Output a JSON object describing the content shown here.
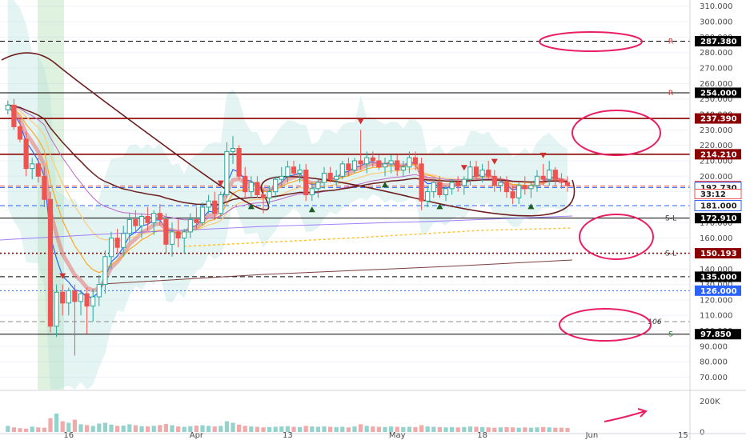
{
  "chart_data": {
    "type": "candlestick",
    "price_axis": {
      "ticks": [
        70,
        80,
        90,
        100,
        110,
        120,
        130,
        140,
        150,
        160,
        170,
        180,
        190,
        200,
        210,
        220,
        230,
        240,
        250,
        260,
        270,
        280,
        290,
        300,
        310
      ],
      "tick_labels": [
        "70.000",
        "80.000",
        "90.000",
        "100.000",
        "110.000",
        "120.000",
        "130.000",
        "140.000",
        "150.000",
        "160.000",
        "170.000",
        "180.000",
        "190.000",
        "200.000",
        "210.000",
        "220.000",
        "230.000",
        "240.000",
        "250.000",
        "260.000",
        "270.000",
        "280.000",
        "290.000",
        "300.000",
        "310.000"
      ],
      "range": [
        62,
        314
      ]
    },
    "volume_axis": {
      "tick_labels": [
        "200K",
        "0"
      ],
      "ticks": [
        200,
        0
      ],
      "range": [
        0,
        260
      ]
    },
    "time_axis": {
      "labels": [
        "16",
        "Apr",
        "13",
        "May",
        "18",
        "Jun",
        "15"
      ],
      "x": [
        10,
        31,
        46,
        64,
        78,
        96,
        111
      ]
    },
    "levels": [
      {
        "value": 287.38,
        "label": "287.380",
        "color": "#000000",
        "style": "dash",
        "marker": "R"
      },
      {
        "value": 254.0,
        "label": "254.000",
        "color": "#000000",
        "style": "solid",
        "marker": "R"
      },
      {
        "value": 237.39,
        "label": "237.390",
        "color": "#8b0000",
        "style": "solid",
        "marker": ""
      },
      {
        "value": 214.21,
        "label": "214.210",
        "color": "#8b0000",
        "style": "solid",
        "marker": ""
      },
      {
        "value": 193.71,
        "label": "193.710",
        "color": "#ef5350",
        "style": "dash",
        "marker": ""
      },
      {
        "value": 192.73,
        "label": "192.730",
        "color": "#2962ff",
        "style": "dash",
        "marker": ""
      },
      {
        "value": 181.0,
        "label": "181.000",
        "color": "#2962ff",
        "style": "dash",
        "marker": ""
      },
      {
        "value": 172.91,
        "label": "172.910",
        "color": "#000000",
        "style": "solid",
        "marker": "S-L"
      },
      {
        "value": 150.193,
        "label": "150.193",
        "color": "#8b0000",
        "style": "dot",
        "marker": "S-L"
      },
      {
        "value": 135.0,
        "label": "135.000",
        "color": "#000000",
        "style": "dash",
        "marker": ""
      },
      {
        "value": 126.0,
        "label": "126.000",
        "color": "#2962ff",
        "style": "dot",
        "marker": ""
      },
      {
        "value": 106.0,
        "label": "",
        "color": "#888888",
        "style": "dash",
        "marker": "106"
      },
      {
        "value": 97.85,
        "label": "97.850",
        "color": "#000000",
        "style": "solid",
        "marker": "S"
      }
    ],
    "countdown": "33:12",
    "candles": [
      [
        0,
        243,
        249,
        240,
        246
      ],
      [
        1,
        246,
        250,
        230,
        232
      ],
      [
        2,
        232,
        237,
        222,
        224
      ],
      [
        3,
        224,
        229,
        200,
        205
      ],
      [
        4,
        205,
        212,
        198,
        208
      ],
      [
        5,
        208,
        212,
        196,
        200
      ],
      [
        6,
        200,
        206,
        180,
        185
      ],
      [
        7,
        185,
        190,
        99,
        103
      ],
      [
        8,
        103,
        130,
        96,
        125
      ],
      [
        9,
        125,
        130,
        110,
        118
      ],
      [
        10,
        118,
        128,
        110,
        126
      ],
      [
        11,
        126,
        130,
        84,
        119
      ],
      [
        12,
        119,
        126,
        110,
        124
      ],
      [
        13,
        124,
        128,
        98,
        116
      ],
      [
        14,
        116,
        127,
        106,
        122
      ],
      [
        15,
        122,
        136,
        116,
        130
      ],
      [
        16,
        130,
        152,
        124,
        148
      ],
      [
        17,
        148,
        164,
        140,
        160
      ],
      [
        18,
        160,
        166,
        150,
        154
      ],
      [
        19,
        154,
        168,
        148,
        163
      ],
      [
        20,
        163,
        176,
        158,
        172
      ],
      [
        21,
        172,
        178,
        163,
        168
      ],
      [
        22,
        168,
        176,
        160,
        174
      ],
      [
        23,
        174,
        180,
        165,
        170
      ],
      [
        24,
        170,
        178,
        162,
        176
      ],
      [
        25,
        176,
        182,
        168,
        172
      ],
      [
        26,
        172,
        176,
        150,
        156
      ],
      [
        27,
        156,
        170,
        148,
        164
      ],
      [
        28,
        164,
        172,
        154,
        160
      ],
      [
        29,
        160,
        166,
        150,
        164
      ],
      [
        30,
        164,
        176,
        160,
        172
      ],
      [
        31,
        172,
        180,
        166,
        170
      ],
      [
        32,
        170,
        183,
        168,
        180
      ],
      [
        33,
        180,
        188,
        176,
        184
      ],
      [
        34,
        184,
        190,
        172,
        176
      ],
      [
        35,
        176,
        190,
        174,
        188
      ],
      [
        36,
        188,
        222,
        186,
        216
      ],
      [
        37,
        216,
        226,
        208,
        218
      ],
      [
        38,
        218,
        220,
        198,
        200
      ],
      [
        39,
        200,
        206,
        186,
        190
      ],
      [
        40,
        190,
        200,
        186,
        196
      ],
      [
        41,
        196,
        200,
        186,
        188
      ],
      [
        42,
        188,
        192,
        176,
        186
      ],
      [
        43,
        186,
        194,
        182,
        190
      ],
      [
        44,
        190,
        200,
        186,
        198
      ],
      [
        45,
        198,
        206,
        194,
        200
      ],
      [
        46,
        200,
        210,
        196,
        206
      ],
      [
        47,
        206,
        210,
        200,
        202
      ],
      [
        48,
        202,
        208,
        196,
        204
      ],
      [
        49,
        204,
        208,
        184,
        188
      ],
      [
        50,
        188,
        196,
        184,
        192
      ],
      [
        51,
        192,
        198,
        186,
        196
      ],
      [
        52,
        196,
        206,
        192,
        202
      ],
      [
        53,
        202,
        206,
        196,
        198
      ],
      [
        54,
        198,
        204,
        194,
        200
      ],
      [
        55,
        200,
        210,
        198,
        208
      ],
      [
        56,
        208,
        212,
        200,
        204
      ],
      [
        57,
        204,
        212,
        202,
        210
      ],
      [
        58,
        210,
        230,
        204,
        208
      ],
      [
        59,
        208,
        216,
        202,
        212
      ],
      [
        60,
        212,
        216,
        206,
        210
      ],
      [
        61,
        210,
        214,
        204,
        206
      ],
      [
        62,
        206,
        212,
        200,
        208
      ],
      [
        63,
        208,
        214,
        202,
        210
      ],
      [
        64,
        210,
        214,
        200,
        204
      ],
      [
        65,
        204,
        210,
        200,
        206
      ],
      [
        66,
        206,
        216,
        202,
        212
      ],
      [
        67,
        212,
        216,
        204,
        208
      ],
      [
        68,
        208,
        212,
        178,
        184
      ],
      [
        69,
        184,
        194,
        180,
        190
      ],
      [
        70,
        190,
        198,
        186,
        196
      ],
      [
        71,
        196,
        200,
        186,
        188
      ],
      [
        72,
        188,
        194,
        184,
        192
      ],
      [
        73,
        192,
        198,
        188,
        196
      ],
      [
        74,
        196,
        200,
        190,
        194
      ],
      [
        75,
        194,
        200,
        188,
        198
      ],
      [
        76,
        198,
        210,
        194,
        206
      ],
      [
        77,
        206,
        210,
        198,
        200
      ],
      [
        78,
        200,
        208,
        196,
        204
      ],
      [
        79,
        204,
        210,
        198,
        200
      ],
      [
        80,
        200,
        204,
        190,
        194
      ],
      [
        81,
        194,
        200,
        190,
        196
      ],
      [
        82,
        196,
        200,
        186,
        190
      ],
      [
        83,
        190,
        194,
        182,
        186
      ],
      [
        84,
        186,
        196,
        182,
        194
      ],
      [
        85,
        194,
        200,
        188,
        192
      ],
      [
        86,
        192,
        196,
        186,
        194
      ],
      [
        87,
        194,
        204,
        190,
        200
      ],
      [
        88,
        200,
        208,
        194,
        198
      ],
      [
        89,
        198,
        210,
        194,
        204
      ],
      [
        90,
        204,
        206,
        194,
        198
      ],
      [
        91,
        198,
        202,
        192,
        196
      ],
      [
        92,
        196,
        200,
        190,
        194
      ]
    ],
    "volume": [
      40,
      30,
      25,
      22,
      35,
      30,
      28,
      90,
      120,
      70,
      60,
      80,
      50,
      45,
      40,
      55,
      60,
      48,
      40,
      42,
      50,
      44,
      38,
      36,
      40,
      45,
      52,
      44,
      36,
      34,
      38,
      42,
      44,
      40,
      36,
      40,
      70,
      60,
      48,
      40,
      36,
      34,
      30,
      32,
      34,
      36,
      38,
      34,
      32,
      40,
      36,
      34,
      36,
      34,
      32,
      34,
      30,
      36,
      50,
      40,
      36,
      34,
      32,
      36,
      34,
      32,
      34,
      32,
      44,
      36,
      34,
      32,
      30,
      32,
      30,
      32,
      36,
      34,
      32,
      30,
      28,
      30,
      32,
      30,
      28,
      30,
      28,
      30,
      32,
      30,
      28,
      28,
      26
    ]
  }
}
